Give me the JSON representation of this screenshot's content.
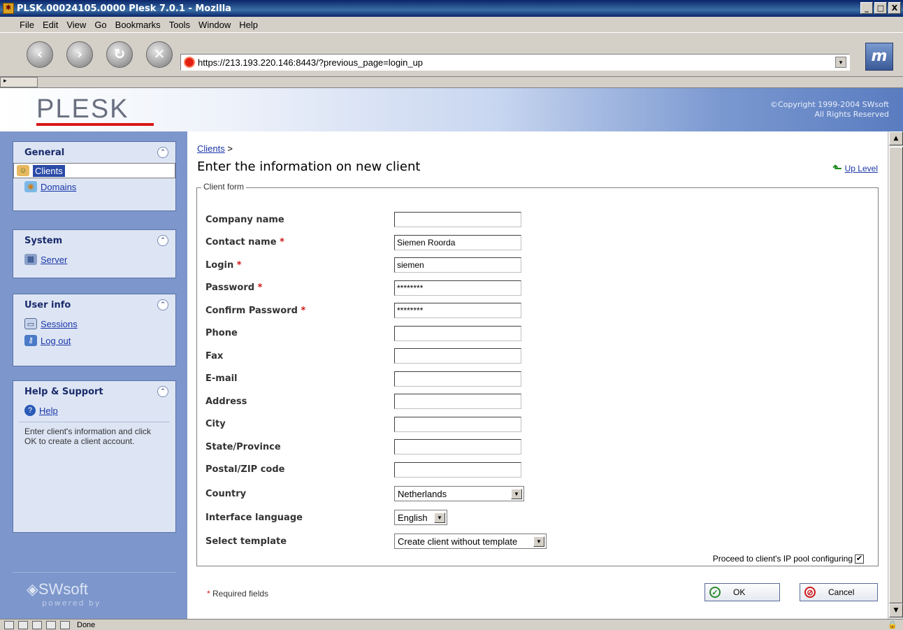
{
  "window": {
    "title": "PLSK.00024105.0000 Plesk 7.0.1 - Mozilla",
    "controls": [
      "_",
      "□",
      "X"
    ]
  },
  "menu": [
    "File",
    "Edit",
    "View",
    "Go",
    "Bookmarks",
    "Tools",
    "Window",
    "Help"
  ],
  "toolbar": {
    "url": "https://213.193.220.146:8443/?previous_page=login_up"
  },
  "header": {
    "logo": "PLESK",
    "copyright_line1": "©Copyright 1999-2004 SWsoft",
    "copyright_line2": "All Rights Reserved"
  },
  "sidebar": {
    "general": {
      "title": "General",
      "items": [
        {
          "label": "Clients"
        },
        {
          "label": "Domains"
        }
      ]
    },
    "system": {
      "title": "System",
      "items": [
        {
          "label": "Server"
        }
      ]
    },
    "userinfo": {
      "title": "User info",
      "items": [
        {
          "label": "Sessions"
        },
        {
          "label": "Log out"
        }
      ]
    },
    "help": {
      "title": "Help & Support",
      "items": [
        {
          "label": "Help"
        }
      ],
      "text": "Enter client's information and click OK to create a client account."
    },
    "brand": "SWsoft",
    "brand_sub": "powered by"
  },
  "main": {
    "breadcrumb": "Clients",
    "breadcrumb_sep": ">",
    "title": "Enter the information on new client",
    "up_level": "Up Level",
    "legend": "Client form",
    "fields": [
      {
        "label": "Company name",
        "value": "",
        "required": false
      },
      {
        "label": "Contact name",
        "value": "Siemen Roorda",
        "required": true
      },
      {
        "label": "Login",
        "value": "siemen",
        "required": true
      },
      {
        "label": "Password",
        "value": "********",
        "required": true
      },
      {
        "label": "Confirm Password",
        "value": "********",
        "required": true
      },
      {
        "label": "Phone",
        "value": "",
        "required": false
      },
      {
        "label": "Fax",
        "value": "",
        "required": false
      },
      {
        "label": "E-mail",
        "value": "",
        "required": false
      },
      {
        "label": "Address",
        "value": "",
        "required": false
      },
      {
        "label": "City",
        "value": "",
        "required": false
      },
      {
        "label": "State/Province",
        "value": "",
        "required": false
      },
      {
        "label": "Postal/ZIP code",
        "value": "",
        "required": false
      }
    ],
    "country_label": "Country",
    "country_value": "Netherlands",
    "language_label": "Interface language",
    "language_value": "English",
    "template_label": "Select template",
    "template_value": "Create client without template",
    "ip_pool_label": "Proceed to client's IP pool configuring",
    "ip_pool_checked": true,
    "required_note": "Required fields",
    "required_mark": "*",
    "ok_label": "OK",
    "cancel_label": "Cancel"
  },
  "status": {
    "text": "Done"
  }
}
